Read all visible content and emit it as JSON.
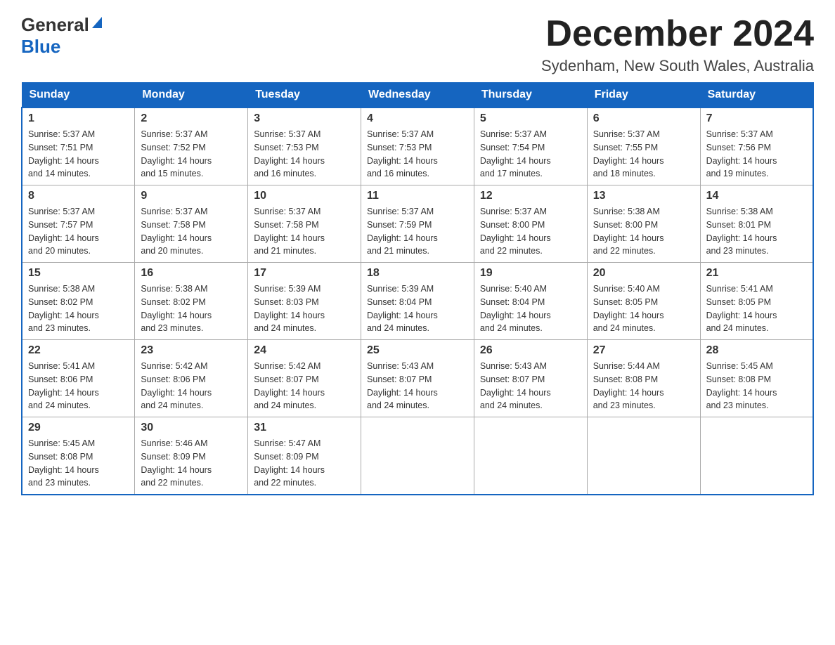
{
  "header": {
    "logo_general": "General",
    "logo_blue": "Blue",
    "month_title": "December 2024",
    "subtitle": "Sydenham, New South Wales, Australia"
  },
  "days_of_week": [
    "Sunday",
    "Monday",
    "Tuesday",
    "Wednesday",
    "Thursday",
    "Friday",
    "Saturday"
  ],
  "weeks": [
    [
      {
        "day": "1",
        "sunrise": "5:37 AM",
        "sunset": "7:51 PM",
        "daylight": "14 hours and 14 minutes."
      },
      {
        "day": "2",
        "sunrise": "5:37 AM",
        "sunset": "7:52 PM",
        "daylight": "14 hours and 15 minutes."
      },
      {
        "day": "3",
        "sunrise": "5:37 AM",
        "sunset": "7:53 PM",
        "daylight": "14 hours and 16 minutes."
      },
      {
        "day": "4",
        "sunrise": "5:37 AM",
        "sunset": "7:53 PM",
        "daylight": "14 hours and 16 minutes."
      },
      {
        "day": "5",
        "sunrise": "5:37 AM",
        "sunset": "7:54 PM",
        "daylight": "14 hours and 17 minutes."
      },
      {
        "day": "6",
        "sunrise": "5:37 AM",
        "sunset": "7:55 PM",
        "daylight": "14 hours and 18 minutes."
      },
      {
        "day": "7",
        "sunrise": "5:37 AM",
        "sunset": "7:56 PM",
        "daylight": "14 hours and 19 minutes."
      }
    ],
    [
      {
        "day": "8",
        "sunrise": "5:37 AM",
        "sunset": "7:57 PM",
        "daylight": "14 hours and 20 minutes."
      },
      {
        "day": "9",
        "sunrise": "5:37 AM",
        "sunset": "7:58 PM",
        "daylight": "14 hours and 20 minutes."
      },
      {
        "day": "10",
        "sunrise": "5:37 AM",
        "sunset": "7:58 PM",
        "daylight": "14 hours and 21 minutes."
      },
      {
        "day": "11",
        "sunrise": "5:37 AM",
        "sunset": "7:59 PM",
        "daylight": "14 hours and 21 minutes."
      },
      {
        "day": "12",
        "sunrise": "5:37 AM",
        "sunset": "8:00 PM",
        "daylight": "14 hours and 22 minutes."
      },
      {
        "day": "13",
        "sunrise": "5:38 AM",
        "sunset": "8:00 PM",
        "daylight": "14 hours and 22 minutes."
      },
      {
        "day": "14",
        "sunrise": "5:38 AM",
        "sunset": "8:01 PM",
        "daylight": "14 hours and 23 minutes."
      }
    ],
    [
      {
        "day": "15",
        "sunrise": "5:38 AM",
        "sunset": "8:02 PM",
        "daylight": "14 hours and 23 minutes."
      },
      {
        "day": "16",
        "sunrise": "5:38 AM",
        "sunset": "8:02 PM",
        "daylight": "14 hours and 23 minutes."
      },
      {
        "day": "17",
        "sunrise": "5:39 AM",
        "sunset": "8:03 PM",
        "daylight": "14 hours and 24 minutes."
      },
      {
        "day": "18",
        "sunrise": "5:39 AM",
        "sunset": "8:04 PM",
        "daylight": "14 hours and 24 minutes."
      },
      {
        "day": "19",
        "sunrise": "5:40 AM",
        "sunset": "8:04 PM",
        "daylight": "14 hours and 24 minutes."
      },
      {
        "day": "20",
        "sunrise": "5:40 AM",
        "sunset": "8:05 PM",
        "daylight": "14 hours and 24 minutes."
      },
      {
        "day": "21",
        "sunrise": "5:41 AM",
        "sunset": "8:05 PM",
        "daylight": "14 hours and 24 minutes."
      }
    ],
    [
      {
        "day": "22",
        "sunrise": "5:41 AM",
        "sunset": "8:06 PM",
        "daylight": "14 hours and 24 minutes."
      },
      {
        "day": "23",
        "sunrise": "5:42 AM",
        "sunset": "8:06 PM",
        "daylight": "14 hours and 24 minutes."
      },
      {
        "day": "24",
        "sunrise": "5:42 AM",
        "sunset": "8:07 PM",
        "daylight": "14 hours and 24 minutes."
      },
      {
        "day": "25",
        "sunrise": "5:43 AM",
        "sunset": "8:07 PM",
        "daylight": "14 hours and 24 minutes."
      },
      {
        "day": "26",
        "sunrise": "5:43 AM",
        "sunset": "8:07 PM",
        "daylight": "14 hours and 24 minutes."
      },
      {
        "day": "27",
        "sunrise": "5:44 AM",
        "sunset": "8:08 PM",
        "daylight": "14 hours and 23 minutes."
      },
      {
        "day": "28",
        "sunrise": "5:45 AM",
        "sunset": "8:08 PM",
        "daylight": "14 hours and 23 minutes."
      }
    ],
    [
      {
        "day": "29",
        "sunrise": "5:45 AM",
        "sunset": "8:08 PM",
        "daylight": "14 hours and 23 minutes."
      },
      {
        "day": "30",
        "sunrise": "5:46 AM",
        "sunset": "8:09 PM",
        "daylight": "14 hours and 22 minutes."
      },
      {
        "day": "31",
        "sunrise": "5:47 AM",
        "sunset": "8:09 PM",
        "daylight": "14 hours and 22 minutes."
      },
      null,
      null,
      null,
      null
    ]
  ],
  "labels": {
    "sunrise": "Sunrise:",
    "sunset": "Sunset:",
    "daylight": "Daylight:"
  }
}
